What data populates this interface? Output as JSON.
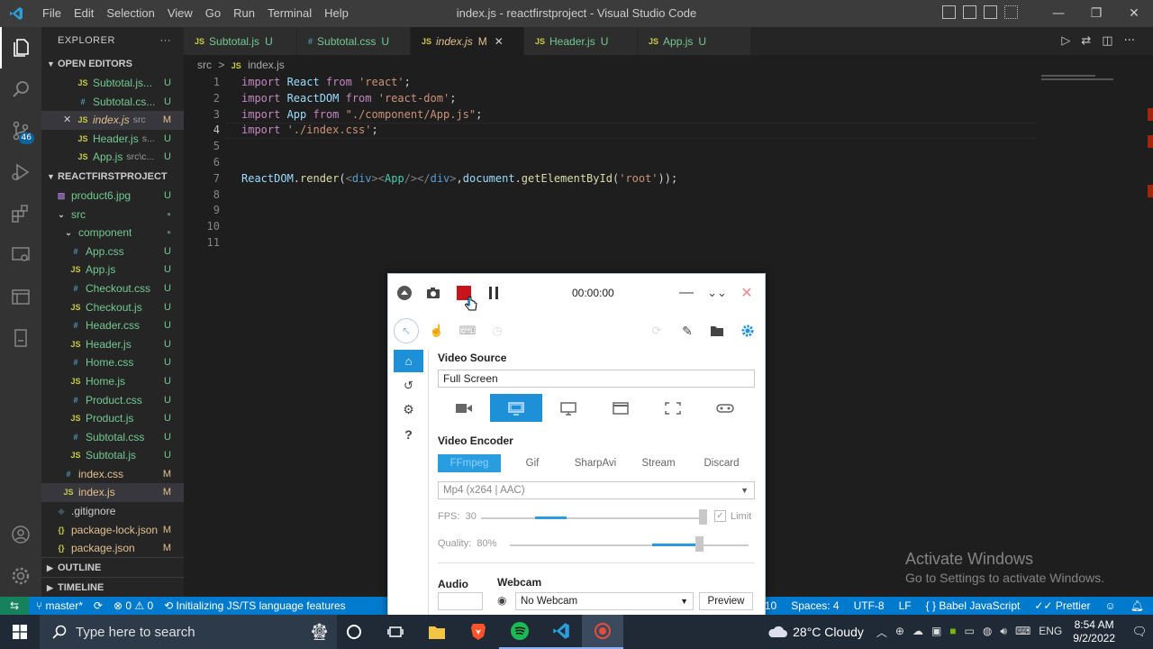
{
  "window": {
    "menu": [
      "File",
      "Edit",
      "Selection",
      "View",
      "Go",
      "Run",
      "Terminal",
      "Help"
    ],
    "title": "index.js - reactfirstproject - Visual Studio Code"
  },
  "activity": {
    "scm_badge": "46"
  },
  "explorer": {
    "header": "EXPLORER",
    "more": "···",
    "open_editors_label": "OPEN EDITORS",
    "open_editors": [
      {
        "icon": "JS",
        "name": "Subtotal.js...",
        "desc": "",
        "status": "U",
        "close": false
      },
      {
        "icon": "#",
        "name": "Subtotal.cs...",
        "desc": "",
        "status": "U",
        "close": false
      },
      {
        "icon": "JS",
        "name": "index.js",
        "desc": "src",
        "status": "M",
        "close": true
      },
      {
        "icon": "JS",
        "name": "Header.js",
        "desc": "s...",
        "status": "U",
        "close": false
      },
      {
        "icon": "JS",
        "name": "App.js",
        "desc": "src\\c...",
        "status": "U",
        "close": false
      }
    ],
    "project_label": "REACTFIRSTPROJECT",
    "tree": [
      {
        "indent": 1,
        "icon": "img",
        "name": "product6.jpg",
        "status": "U"
      },
      {
        "indent": 1,
        "icon": "folder",
        "name": "src",
        "status": "●"
      },
      {
        "indent": 2,
        "icon": "folder",
        "name": "component",
        "status": "●"
      },
      {
        "indent": 3,
        "icon": "#",
        "name": "App.css",
        "status": "U"
      },
      {
        "indent": 3,
        "icon": "JS",
        "name": "App.js",
        "status": "U"
      },
      {
        "indent": 3,
        "icon": "#",
        "name": "Checkout.css",
        "status": "U"
      },
      {
        "indent": 3,
        "icon": "JS",
        "name": "Checkout.js",
        "status": "U"
      },
      {
        "indent": 3,
        "icon": "#",
        "name": "Header.css",
        "status": "U"
      },
      {
        "indent": 3,
        "icon": "JS",
        "name": "Header.js",
        "status": "U"
      },
      {
        "indent": 3,
        "icon": "#",
        "name": "Home.css",
        "status": "U"
      },
      {
        "indent": 3,
        "icon": "JS",
        "name": "Home.js",
        "status": "U"
      },
      {
        "indent": 3,
        "icon": "#",
        "name": "Product.css",
        "status": "U"
      },
      {
        "indent": 3,
        "icon": "JS",
        "name": "Product.js",
        "status": "U"
      },
      {
        "indent": 3,
        "icon": "#",
        "name": "Subtotal.css",
        "status": "U"
      },
      {
        "indent": 3,
        "icon": "JS",
        "name": "Subtotal.js",
        "status": "U"
      },
      {
        "indent": 2,
        "icon": "#",
        "name": "index.css",
        "status": "M"
      },
      {
        "indent": 2,
        "icon": "JS",
        "name": "index.js",
        "status": "M",
        "selected": true
      },
      {
        "indent": 1,
        "icon": "git",
        "name": ".gitignore",
        "status": ""
      },
      {
        "indent": 1,
        "icon": "{}",
        "name": "package-lock.json",
        "status": "M"
      },
      {
        "indent": 1,
        "icon": "{}",
        "name": "package.json",
        "status": "M"
      }
    ],
    "outline_label": "OUTLINE",
    "timeline_label": "TIMELINE"
  },
  "tabs": [
    {
      "icon": "JS",
      "name": "Subtotal.js",
      "status": "U",
      "active": false
    },
    {
      "icon": "#",
      "name": "Subtotal.css",
      "status": "U",
      "active": false
    },
    {
      "icon": "JS",
      "name": "index.js",
      "status": "M",
      "active": true
    },
    {
      "icon": "JS",
      "name": "Header.js",
      "status": "U",
      "active": false
    },
    {
      "icon": "JS",
      "name": "App.js",
      "status": "U",
      "active": false
    }
  ],
  "breadcrumb": {
    "folder": "src",
    "sep": ">",
    "icon": "JS",
    "file": "index.js"
  },
  "code": {
    "line_numbers": [
      "1",
      "2",
      "3",
      "4",
      "5",
      "6",
      "7",
      "8",
      "9",
      "10",
      "11"
    ],
    "current_line": 4,
    "lines": [
      [
        {
          "c": "kw",
          "t": "import "
        },
        {
          "c": "var",
          "t": "React"
        },
        {
          "c": "kw",
          "t": " from "
        },
        {
          "c": "str",
          "t": "'react'"
        },
        {
          "c": "",
          "t": ";"
        }
      ],
      [
        {
          "c": "kw",
          "t": "import "
        },
        {
          "c": "var",
          "t": "ReactDOM"
        },
        {
          "c": "kw",
          "t": " from "
        },
        {
          "c": "str",
          "t": "'react-dom'"
        },
        {
          "c": "",
          "t": ";"
        }
      ],
      [
        {
          "c": "kw",
          "t": "import "
        },
        {
          "c": "var",
          "t": "App"
        },
        {
          "c": "kw",
          "t": " from "
        },
        {
          "c": "str",
          "t": "\"./component/App.js\""
        },
        {
          "c": "",
          "t": ";"
        }
      ],
      [
        {
          "c": "kw",
          "t": "import "
        },
        {
          "c": "str",
          "t": "'./index.css'"
        },
        {
          "c": "",
          "t": ";"
        }
      ],
      [],
      [],
      [
        {
          "c": "var",
          "t": "ReactDOM"
        },
        {
          "c": "",
          "t": "."
        },
        {
          "c": "fn",
          "t": "render"
        },
        {
          "c": "",
          "t": "("
        },
        {
          "c": "punc",
          "t": "<"
        },
        {
          "c": "tag",
          "t": "div"
        },
        {
          "c": "punc",
          "t": ">"
        },
        {
          "c": "punc",
          "t": "<"
        },
        {
          "c": "cls",
          "t": "App"
        },
        {
          "c": "punc",
          "t": "/>"
        },
        {
          "c": "punc",
          "t": "</"
        },
        {
          "c": "tag",
          "t": "div"
        },
        {
          "c": "punc",
          "t": ">"
        },
        {
          "c": "",
          "t": ","
        },
        {
          "c": "var",
          "t": "document"
        },
        {
          "c": "",
          "t": "."
        },
        {
          "c": "fn",
          "t": "getElementById"
        },
        {
          "c": "",
          "t": "("
        },
        {
          "c": "str",
          "t": "'root'"
        },
        {
          "c": "",
          "t": "));"
        }
      ],
      [],
      [],
      [],
      []
    ]
  },
  "status": {
    "branch": "master*",
    "errors": "0",
    "warnings": "0",
    "message": "Initializing JS/TS language features",
    "col": "Col 10",
    "spaces": "Spaces: 4",
    "encoding": "UTF-8",
    "eol": "LF",
    "language": "Babel JavaScript",
    "prettier": "Prettier"
  },
  "watermark": {
    "title": "Activate Windows",
    "subtitle": "Go to Settings to activate Windows."
  },
  "taskbar": {
    "search_placeholder": "Type here to search",
    "weather": "28°C  Cloudy",
    "lang": "ENG",
    "time": "8:54 AM",
    "date": "9/2/2022"
  },
  "capture": {
    "timer": "00:00:00",
    "video_source_label": "Video Source",
    "video_source_value": "Full Screen",
    "video_encoder_label": "Video Encoder",
    "encoder_tabs": [
      "FFmpeg",
      "Gif",
      "SharpAvi",
      "Stream",
      "Discard"
    ],
    "encoder_format": "Mp4 (x264 | AAC)",
    "fps_label": "FPS:",
    "fps_value": "30",
    "limit_label": "Limit",
    "quality_label": "Quality:",
    "quality_value": "80%",
    "audio_label": "Audio",
    "webcam_label": "Webcam",
    "webcam_value": "No Webcam",
    "preview_label": "Preview"
  },
  "colors": {
    "accent": "#007acc",
    "capture_accent": "#1e90d8",
    "stop": "#c8151b"
  }
}
